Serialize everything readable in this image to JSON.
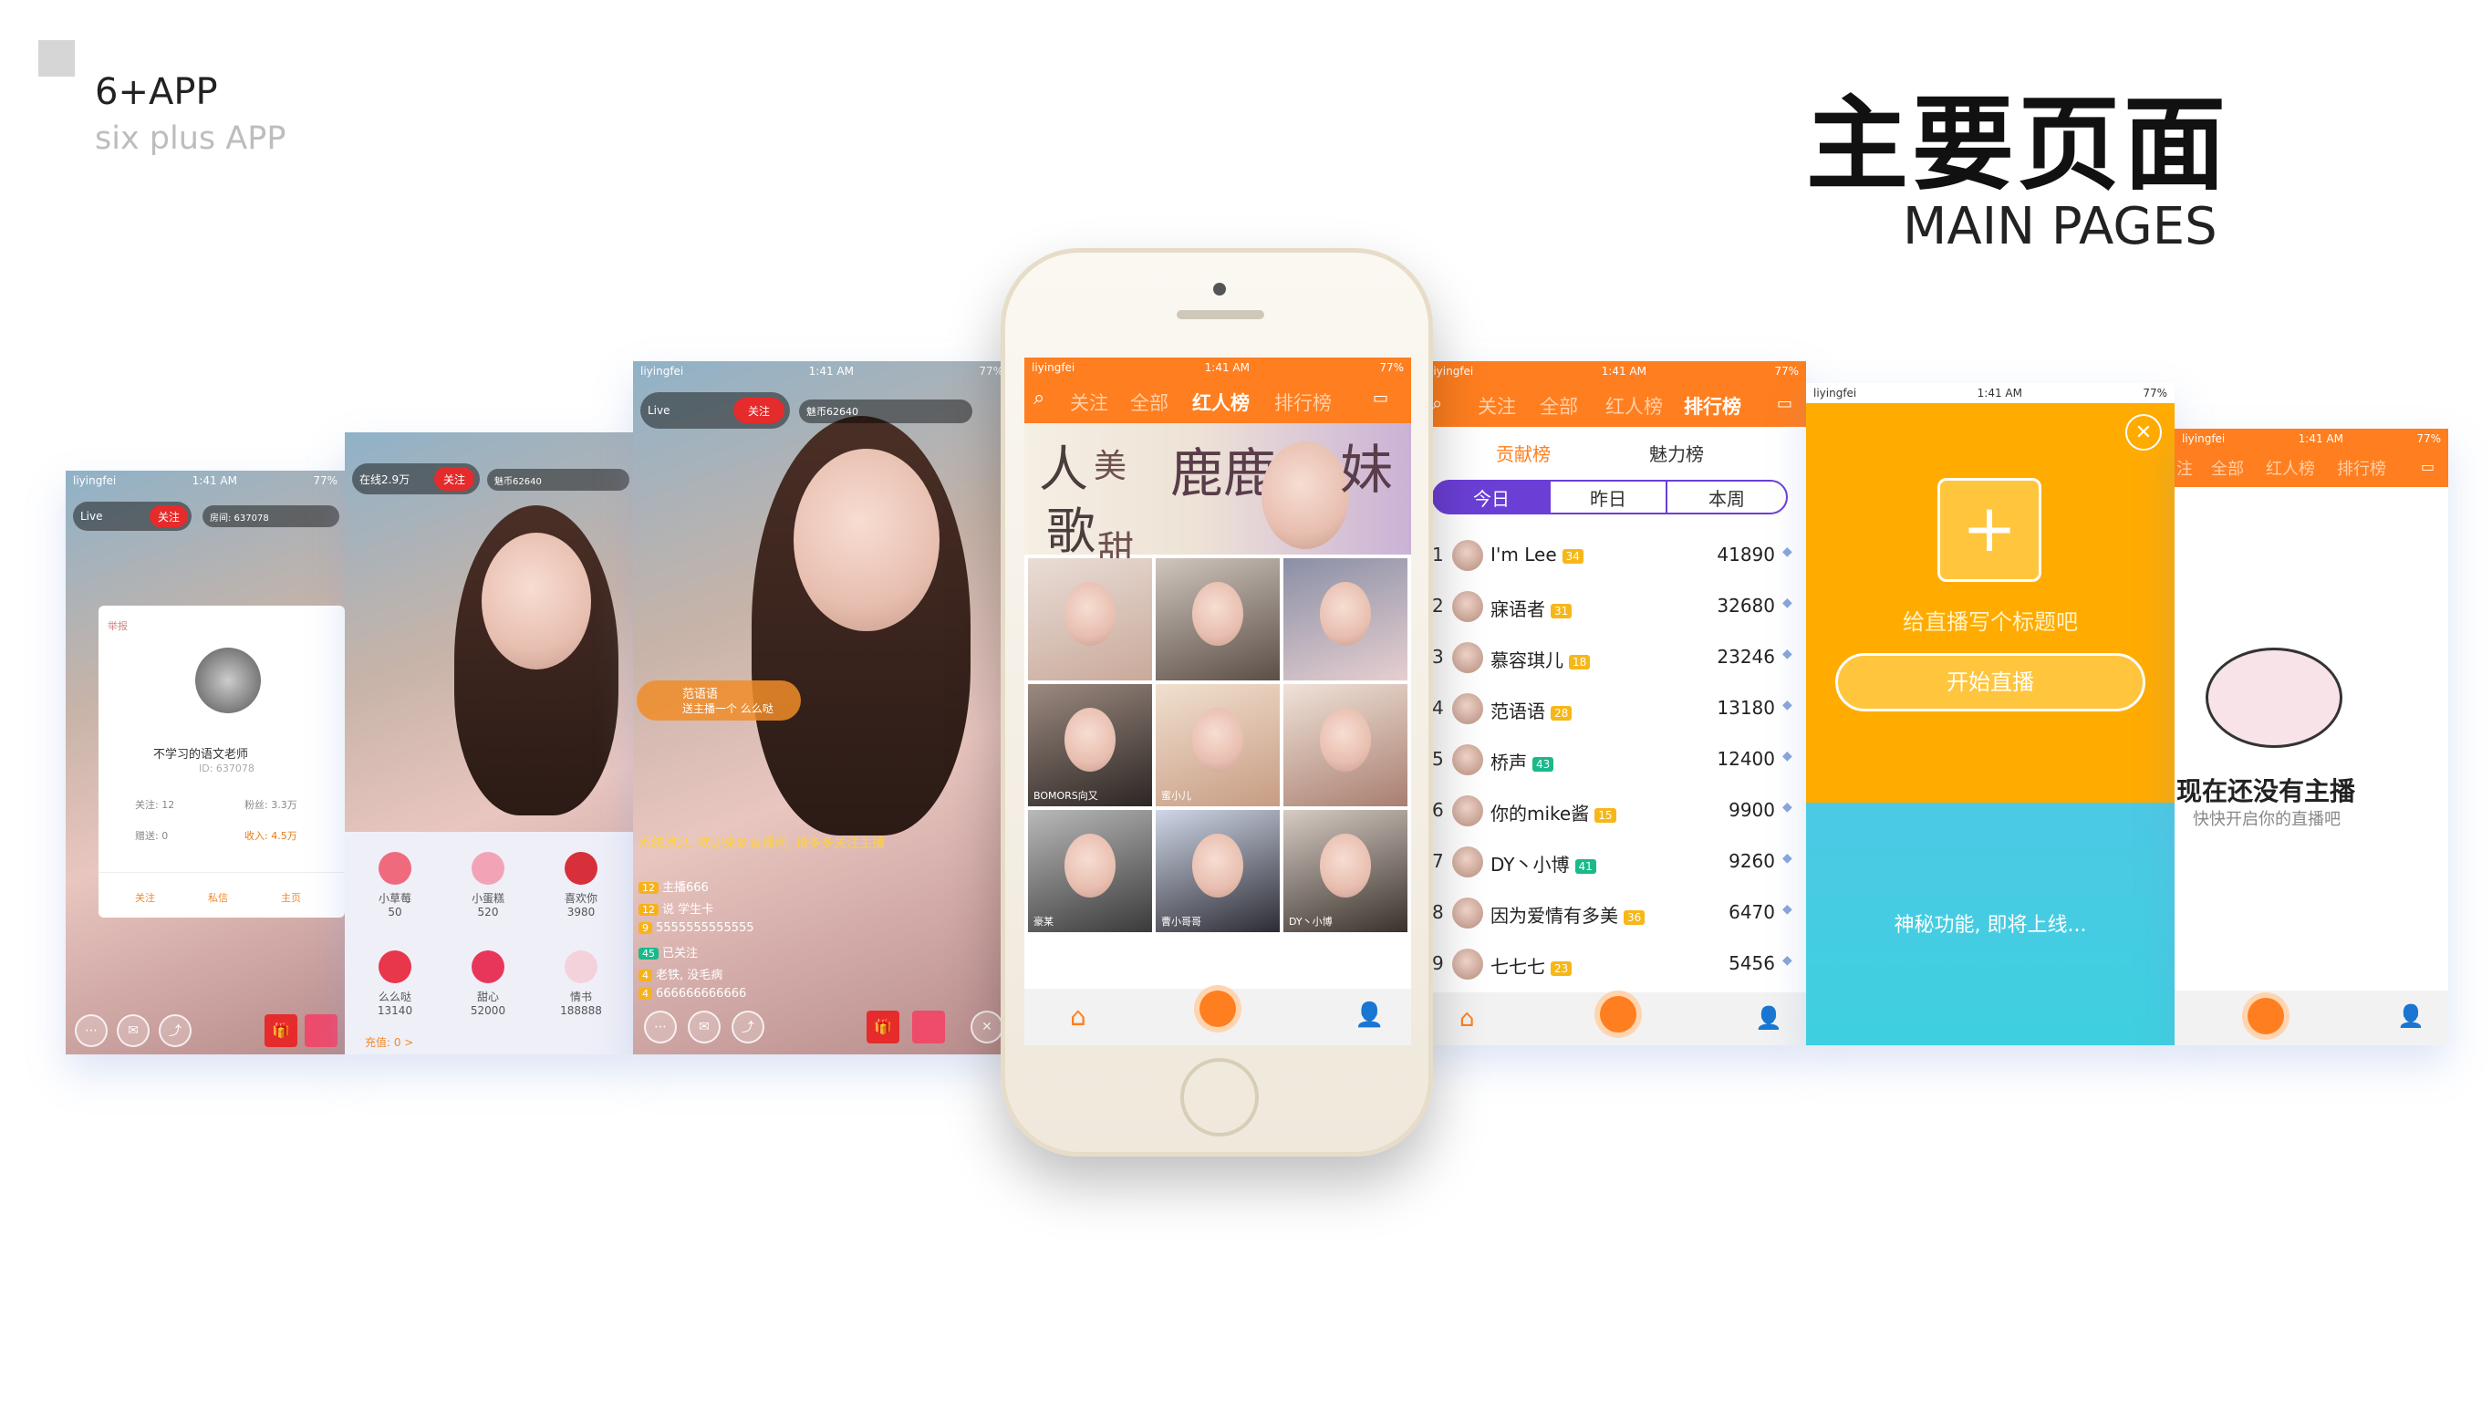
{
  "header": {
    "brand_title": "6+APP",
    "brand_subtitle": "six plus APP",
    "main_title": "主要页面",
    "main_subtitle": "MAIN PAGES"
  },
  "colors": {
    "accent_orange": "#ff7e1f",
    "follow_red": "#e52b2b",
    "purple": "#6b3fd6",
    "yellow_panel": "#ffab00",
    "cyan_panel": "#2ec7dc"
  },
  "status": {
    "carrier": "liyingfei",
    "time": "1:41 AM",
    "battery": "77%"
  },
  "live": {
    "host_name": "Live",
    "host_online": "在线2.9万",
    "follow_label": "关注",
    "coins": "魅币62640",
    "room": "房间: 637078",
    "comment_user": "范语语",
    "comment_text": "送主播一个 么么哒",
    "system_msg": "系统消息: 欢迎来到直播间, 请多多关注主播",
    "chat": [
      {
        "level": "12",
        "text": "主播666"
      },
      {
        "level": "12",
        "text": "说 学生卡"
      },
      {
        "level": "9",
        "text": "5555555555555"
      },
      {
        "level": "45",
        "text": "已关注"
      },
      {
        "level": "4",
        "text": "老铁, 没毛病"
      },
      {
        "level": "4",
        "text": "666666666666"
      }
    ],
    "profile_card": {
      "report": "举报",
      "name": "不学习的语文老师",
      "id": "ID: 637078",
      "follow_count": "关注: 12",
      "fans_count": "粉丝: 3.3万",
      "gifts_sent": "赠送: 0",
      "income": "收入: 4.5万",
      "btn_follow": "关注",
      "btn_message": "私信",
      "btn_home": "主页"
    },
    "gifts": [
      {
        "name": "小草莓",
        "price": "50"
      },
      {
        "name": "小蛋糕",
        "price": "520"
      },
      {
        "name": "喜欢你",
        "price": "3980"
      },
      {
        "name": "么么哒",
        "price": "13140"
      },
      {
        "name": "甜心",
        "price": "52000"
      },
      {
        "name": "情书",
        "price": "188888"
      }
    ],
    "recharge": "充值: 0 >"
  },
  "nav": {
    "tabs": [
      "关注",
      "全部",
      "红人榜",
      "排行榜"
    ],
    "active_center": "红人榜",
    "active_rank": "排行榜"
  },
  "grid": {
    "banner_text": [
      "人",
      "美",
      "歌",
      "甜",
      "鹿鹿",
      "妹"
    ],
    "tiles": [
      {
        "label": ""
      },
      {
        "label": ""
      },
      {
        "label": ""
      },
      {
        "label": "BOMORS向又"
      },
      {
        "label": "蜜小儿"
      },
      {
        "label": ""
      },
      {
        "label": "豪某"
      },
      {
        "label": "曹小哥哥"
      },
      {
        "label": "DY丶小博"
      }
    ]
  },
  "ranking": {
    "tabs": [
      "贡献榜",
      "魅力榜"
    ],
    "periods": [
      "今日",
      "昨日",
      "本周"
    ],
    "rows": [
      {
        "rank": "1",
        "name": "I'm Lee",
        "level": "34",
        "score": "41890"
      },
      {
        "rank": "2",
        "name": "寐语者",
        "level": "31",
        "score": "32680"
      },
      {
        "rank": "3",
        "name": "慕容琪儿",
        "level": "18",
        "score": "23246"
      },
      {
        "rank": "4",
        "name": "范语语",
        "level": "28",
        "score": "13180"
      },
      {
        "rank": "5",
        "name": "桥声",
        "level": "43",
        "score": "12400"
      },
      {
        "rank": "6",
        "name": "你的mike酱",
        "level": "15",
        "score": "9900"
      },
      {
        "rank": "7",
        "name": "DY丶小博",
        "level": "41",
        "score": "9260"
      },
      {
        "rank": "8",
        "name": "因为爱情有多美",
        "level": "36",
        "score": "6470"
      },
      {
        "rank": "9",
        "name": "七七七",
        "level": "23",
        "score": "5456"
      }
    ]
  },
  "start_live": {
    "title_prompt": "给直播写个标题吧",
    "start_button": "开始直播",
    "coming_soon": "神秘功能, 即将上线..."
  },
  "empty": {
    "title": "现在还没有主播",
    "subtitle": "快快开启你的直播吧",
    "tabs": [
      "注",
      "全部",
      "红人榜",
      "排行榜"
    ]
  }
}
